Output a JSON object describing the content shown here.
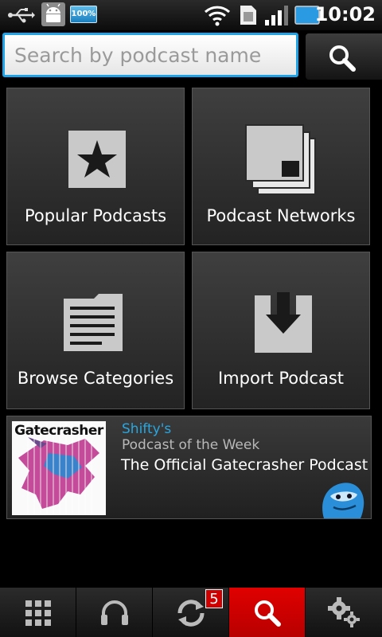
{
  "status_bar": {
    "time": "10:02",
    "battery_percent": "100%",
    "icons": [
      "usb-icon",
      "android-debug-icon",
      "battery-indicator-icon",
      "wifi-icon",
      "sim-card-icon",
      "signal-icon",
      "battery-icon"
    ]
  },
  "search": {
    "placeholder": "Search by podcast name",
    "value": "",
    "button_icon": "search-icon"
  },
  "tiles": [
    {
      "label": "Popular Podcasts",
      "icon": "star-icon"
    },
    {
      "label": "Podcast Networks",
      "icon": "stacked-pages-icon"
    },
    {
      "label": "Browse Categories",
      "icon": "document-list-icon"
    },
    {
      "label": "Import Podcast",
      "icon": "download-icon"
    }
  ],
  "featured": {
    "provider": "Shifty's",
    "heading": "Podcast of the Week",
    "title": "The Official Gatecrasher Podcast",
    "thumbnail_text": "Gatecrasher",
    "mascot_icon": "blue-blob-mascot-icon"
  },
  "bottom_nav": {
    "items": [
      {
        "icon": "grid-icon",
        "active": false
      },
      {
        "icon": "headphones-icon",
        "active": false
      },
      {
        "icon": "sync-icon",
        "active": false,
        "badge": "5"
      },
      {
        "icon": "search-icon",
        "active": true
      },
      {
        "icon": "settings-gears-icon",
        "active": false
      }
    ]
  },
  "colors": {
    "accent_blue": "#1fa3e8",
    "active_red": "#cc0000",
    "provider_text": "#2aa6df"
  }
}
